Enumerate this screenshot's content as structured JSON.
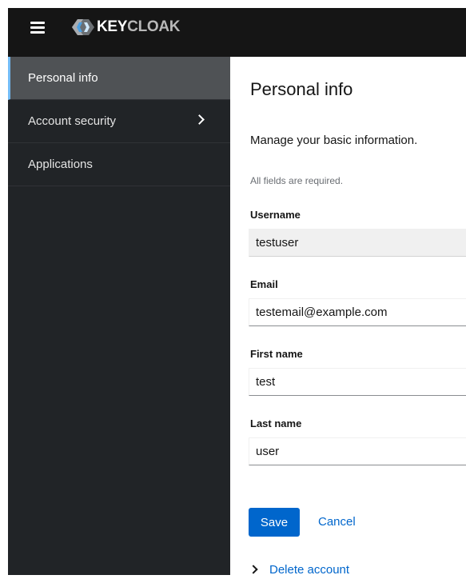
{
  "header": {
    "brand_text_1": "KEY",
    "brand_text_2": "CLOAK",
    "menu_icon": "hamburger-icon",
    "logo_icon": "keycloak-logo-icon"
  },
  "sidebar": {
    "items": [
      {
        "label": "Personal info",
        "active": true
      },
      {
        "label": "Account security",
        "has_children": true,
        "icon": "chevron-right-icon"
      },
      {
        "label": "Applications"
      }
    ]
  },
  "main": {
    "title": "Personal info",
    "description": "Manage your basic information.",
    "required_note": "All fields are required.",
    "fields": {
      "username": {
        "label": "Username",
        "value": "testuser",
        "readonly": true
      },
      "email": {
        "label": "Email",
        "value": "testemail@example.com"
      },
      "first_name": {
        "label": "First name",
        "value": "test"
      },
      "last_name": {
        "label": "Last name",
        "value": "user"
      }
    },
    "save_label": "Save",
    "cancel_label": "Cancel",
    "delete_account_label": "Delete account"
  },
  "colors": {
    "masthead_bg": "#151515",
    "sidebar_bg": "#212427",
    "active_item_bg": "#4f5255",
    "active_indicator": "#73bcf7",
    "primary": "#0066cc"
  }
}
